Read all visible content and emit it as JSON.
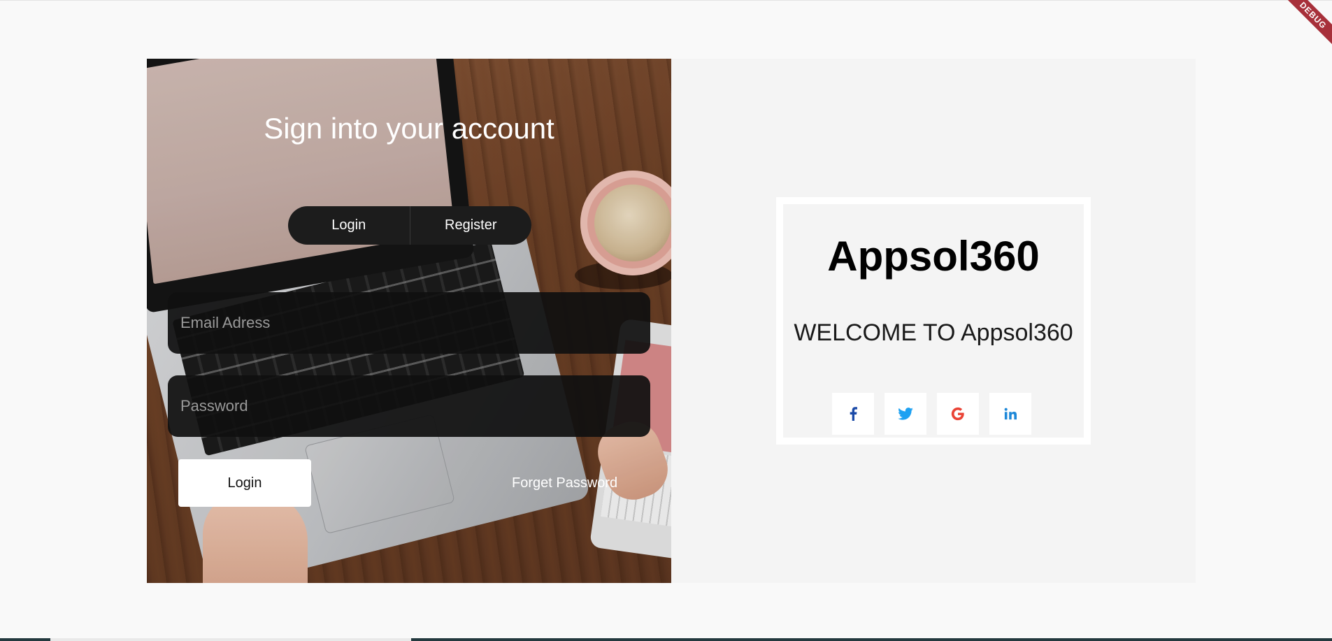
{
  "signin": {
    "title": "Sign into your account",
    "tab_login": "Login",
    "tab_register": "Register",
    "email_placeholder": "Email Adress",
    "password_placeholder": "Password",
    "login_button": "Login",
    "forget_password": "Forget Password"
  },
  "welcome": {
    "brand": "Appsol360",
    "message": "WELCOME TO Appsol360",
    "social": [
      {
        "icon": "facebook-icon",
        "color": "#1b4aa8"
      },
      {
        "icon": "twitter-icon",
        "color": "#1da1f2"
      },
      {
        "icon": "google-icon",
        "color": "#ea4335"
      },
      {
        "icon": "linkedin-icon",
        "color": "#1e88d8"
      }
    ]
  },
  "debug_banner": "DEBUG",
  "colors": {
    "page_bg": "#f9f9f9",
    "right_panel_bg": "#f4f4f4",
    "debug_banner": "#a7303a",
    "field_bg": "#101010",
    "toggle_bg": "#1c1c1c"
  }
}
